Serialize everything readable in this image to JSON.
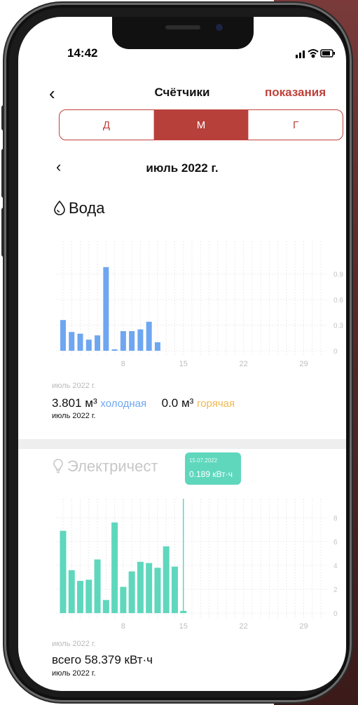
{
  "status": {
    "time": "14:42"
  },
  "nav": {
    "title": "Счётчики",
    "action": "показания"
  },
  "tabs": [
    {
      "label": "Д",
      "active": false
    },
    {
      "label": "М",
      "active": true
    },
    {
      "label": "Г",
      "active": false
    }
  ],
  "period": {
    "label": "июль 2022 г."
  },
  "water": {
    "title": "Вода",
    "caption": "июль 2022 г.",
    "cold_value": "3.801 м³",
    "cold_label": "холодная",
    "hot_value": "0.0 м³",
    "hot_label": "горячая",
    "date": "июль 2022 г."
  },
  "electricity": {
    "title": "Электричест",
    "caption": "июль 2022 г.",
    "total": "всего 58.379 кВт·ч",
    "date": "июль 2022 г.",
    "tooltip_date": "15.07.2022",
    "tooltip_value": "0.189 кВт·ч"
  },
  "colors": {
    "accent": "#c0413b",
    "water_bar": "#6ea6f1",
    "elec_bar": "#5fd7bd",
    "cold": "#6ea6f1",
    "hot": "#f0b84e"
  },
  "chart_data": [
    {
      "type": "bar",
      "x": [
        1,
        2,
        3,
        4,
        5,
        6,
        7,
        8,
        9,
        10,
        11,
        12,
        13,
        14
      ],
      "values": [
        0.36,
        0.22,
        0.2,
        0.13,
        0.18,
        0.98,
        0.01,
        0.23,
        0.23,
        0.25,
        0.34,
        0.1,
        0.0,
        0.0
      ],
      "x_ticks": [
        "8",
        "15",
        "22",
        "29"
      ],
      "y_ticks": [
        "0.9",
        "0.6",
        "0.3",
        "0"
      ],
      "ylim": [
        0,
        1.2
      ],
      "xlim": [
        1,
        31
      ],
      "grid": true
    },
    {
      "type": "bar",
      "x": [
        1,
        2,
        3,
        4,
        5,
        6,
        7,
        8,
        9,
        10,
        11,
        12,
        13,
        14,
        15
      ],
      "values": [
        6.9,
        3.6,
        2.7,
        2.8,
        4.5,
        1.1,
        7.6,
        2.2,
        3.5,
        4.3,
        4.2,
        3.8,
        5.6,
        3.9,
        0.189
      ],
      "x_ticks": [
        "8",
        "15",
        "22",
        "29"
      ],
      "y_ticks": [
        "8",
        "6",
        "4",
        "2",
        "0"
      ],
      "ylim": [
        0,
        9
      ],
      "xlim": [
        1,
        31
      ],
      "grid": true
    }
  ]
}
